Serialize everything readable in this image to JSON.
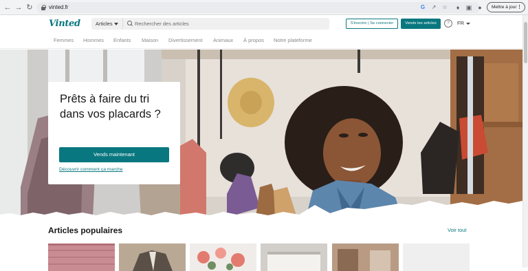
{
  "browser": {
    "url": "vinted.fr",
    "update_label": "Mettre à jour",
    "icons": [
      "back-icon",
      "forward-icon",
      "reload-icon",
      "google-icon",
      "share-icon",
      "star-icon",
      "extensions-icon",
      "sidebar-icon",
      "profile-icon"
    ]
  },
  "header": {
    "logo": "Vinted",
    "category_select": "Articles",
    "search_placeholder": "Rechercher des articles",
    "signup_label": "S'inscrire | Se connecter",
    "sell_label": "Vends tes articles",
    "help_label": "?",
    "language": "FR"
  },
  "nav": {
    "items": [
      "Femmes",
      "Hommes",
      "Enfants",
      "Maison",
      "Divertissement",
      "Animaux",
      "À propos",
      "Notre plateforme"
    ]
  },
  "hero": {
    "title": "Prêts à faire du tri dans vos placards ?",
    "cta_label": "Vends maintenant",
    "link_label": "Découvrir comment ça marche"
  },
  "popular": {
    "title": "Articles populaires",
    "see_all": "Voir tout"
  },
  "colors": {
    "brand": "#09777f",
    "text": "#171717",
    "muted": "#8a8a8a"
  }
}
